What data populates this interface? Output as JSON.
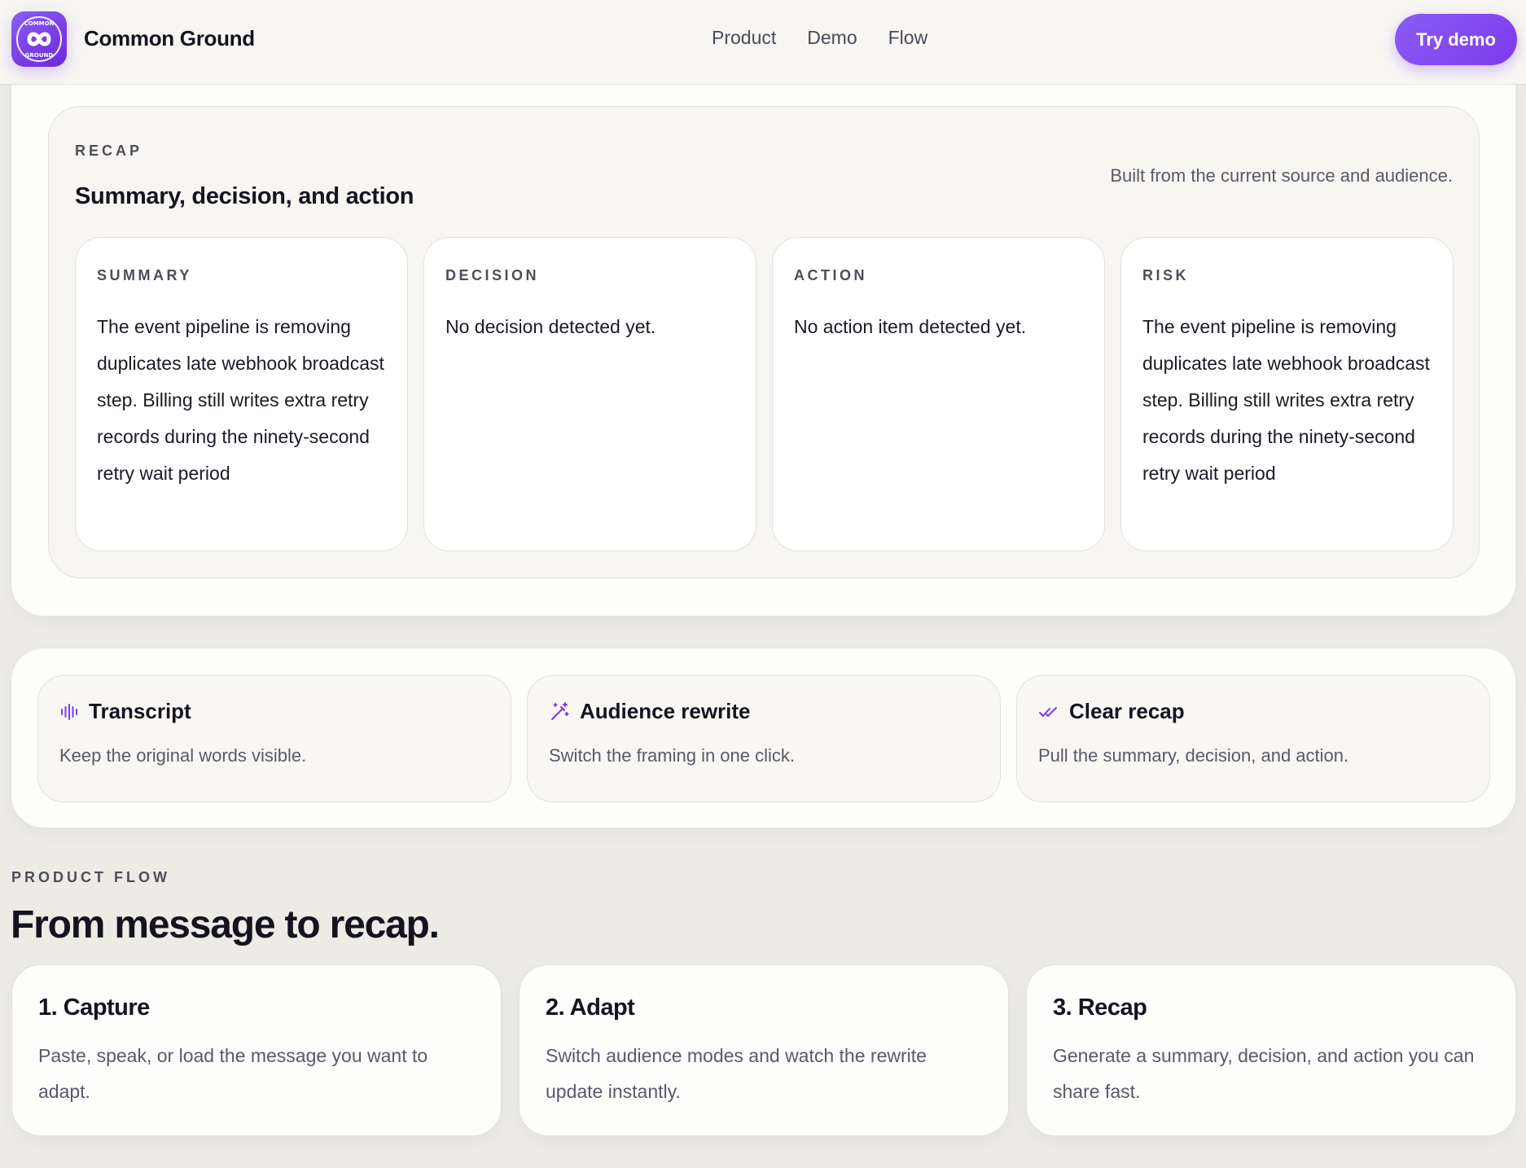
{
  "brand": {
    "name": "Common Ground",
    "logo_text_top": "COMMON",
    "logo_text_bottom": "GROUND"
  },
  "nav": {
    "items": [
      "Product",
      "Demo",
      "Flow"
    ],
    "cta": "Try demo"
  },
  "recap": {
    "eyebrow": "RECAP",
    "title": "Summary, decision, and action",
    "note": "Built from the current source and audience.",
    "cards": [
      {
        "label": "SUMMARY",
        "text": "The event pipeline is removing duplicates late webhook broadcast step. Billing still writes extra retry records during the ninety-second retry wait period"
      },
      {
        "label": "DECISION",
        "text": "No decision detected yet."
      },
      {
        "label": "ACTION",
        "text": "No action item detected yet."
      },
      {
        "label": "RISK",
        "text": "The event pipeline is removing duplicates late webhook broadcast step. Billing still writes extra retry records during the ninety-second retry wait period"
      }
    ]
  },
  "features": [
    {
      "icon": "audio-wave-icon",
      "title": "Transcript",
      "desc": "Keep the original words visible."
    },
    {
      "icon": "magic-wand-icon",
      "title": "Audience rewrite",
      "desc": "Switch the framing in one click."
    },
    {
      "icon": "double-check-icon",
      "title": "Clear recap",
      "desc": "Pull the summary, decision, and action."
    }
  ],
  "flow": {
    "eyebrow": "PRODUCT FLOW",
    "title": "From message to recap.",
    "steps": [
      {
        "title": "1. Capture",
        "desc": "Paste, speak, or load the message you want to adapt."
      },
      {
        "title": "2. Adapt",
        "desc": "Switch audience modes and watch the rewrite update instantly."
      },
      {
        "title": "3. Recap",
        "desc": "Generate a summary, decision, and action you can share fast."
      }
    ]
  },
  "colors": {
    "accent": "#7c3aed",
    "accent_light": "#8b5cf6",
    "page_bg": "#ecebe6",
    "text_dark": "#16131f",
    "text_muted": "#5b5868"
  }
}
